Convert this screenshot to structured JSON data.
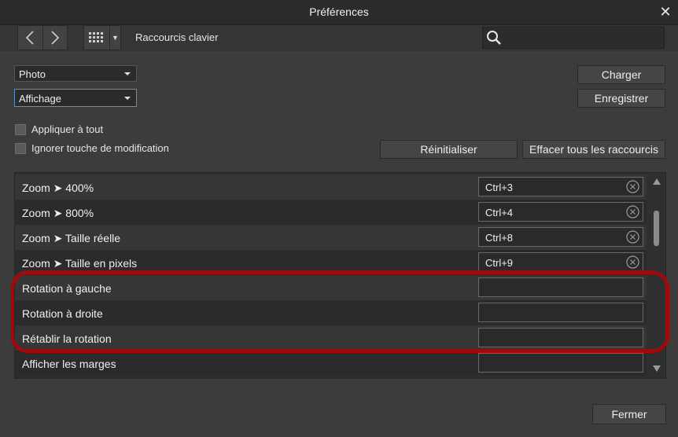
{
  "window": {
    "title": "Préférences"
  },
  "toolbar": {
    "section": "Raccourcis clavier",
    "search_placeholder": ""
  },
  "dropdowns": {
    "persona": "Photo",
    "category": "Affichage"
  },
  "buttons": {
    "load": "Charger",
    "save": "Enregistrer",
    "reset": "Réinitialiser",
    "clear_all": "Effacer tous les raccourcis",
    "close": "Fermer"
  },
  "checkboxes": {
    "apply_all": "Appliquer à tout",
    "ignore_modifier": "Ignorer touche de modification"
  },
  "shortcuts": [
    {
      "label": "Zoom ➤ 400%",
      "value": "Ctrl+3"
    },
    {
      "label": "Zoom ➤ 800%",
      "value": "Ctrl+4"
    },
    {
      "label": "Zoom ➤ Taille réelle",
      "value": "Ctrl+8"
    },
    {
      "label": "Zoom ➤ Taille en pixels",
      "value": "Ctrl+9"
    },
    {
      "label": "Rotation à gauche",
      "value": ""
    },
    {
      "label": "Rotation à droite",
      "value": ""
    },
    {
      "label": "Rétablir la rotation",
      "value": ""
    },
    {
      "label": "Afficher les marges",
      "value": ""
    }
  ],
  "colors": {
    "highlight": "#9b0d0d",
    "focus": "#5a8fd8"
  }
}
